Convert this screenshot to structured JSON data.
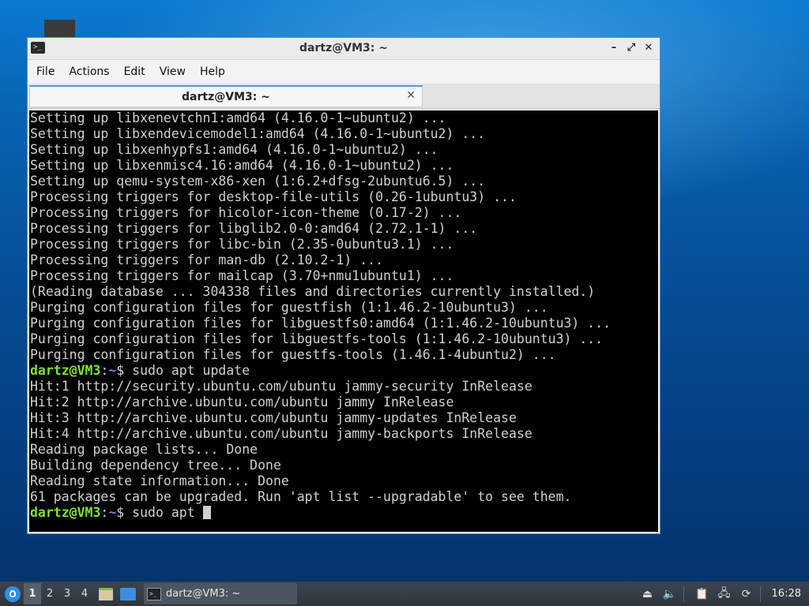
{
  "window": {
    "title": "dartz@VM3: ~",
    "controls": {
      "minimize": "–",
      "maximize": "⤢",
      "close": "✕"
    }
  },
  "menu": [
    "File",
    "Actions",
    "Edit",
    "View",
    "Help"
  ],
  "tab": {
    "label": "dartz@VM3: ~",
    "close": "✕"
  },
  "terminal": {
    "lines": [
      "Setting up libxenevtchn1:amd64 (4.16.0-1~ubuntu2) ...",
      "Setting up libxendevicemodel1:amd64 (4.16.0-1~ubuntu2) ...",
      "Setting up libxenhypfs1:amd64 (4.16.0-1~ubuntu2) ...",
      "Setting up libxenmisc4.16:amd64 (4.16.0-1~ubuntu2) ...",
      "Setting up qemu-system-x86-xen (1:6.2+dfsg-2ubuntu6.5) ...",
      "Processing triggers for desktop-file-utils (0.26-1ubuntu3) ...",
      "Processing triggers for hicolor-icon-theme (0.17-2) ...",
      "Processing triggers for libglib2.0-0:amd64 (2.72.1-1) ...",
      "Processing triggers for libc-bin (2.35-0ubuntu3.1) ...",
      "Processing triggers for man-db (2.10.2-1) ...",
      "Processing triggers for mailcap (3.70+nmu1ubuntu1) ...",
      "(Reading database ... 304338 files and directories currently installed.)",
      "Purging configuration files for guestfish (1:1.46.2-10ubuntu3) ...",
      "Purging configuration files for libguestfs0:amd64 (1:1.46.2-10ubuntu3) ...",
      "Purging configuration files for libguestfs-tools (1:1.46.2-10ubuntu3) ...",
      "Purging configuration files for guestfs-tools (1.46.1-4ubuntu2) ...",
      {
        "prompt_user": "dartz@VM3",
        "prompt_sep": ":",
        "prompt_path": "~",
        "prompt_end": "$ ",
        "command": "sudo apt update"
      },
      "Hit:1 http://security.ubuntu.com/ubuntu jammy-security InRelease",
      "Hit:2 http://archive.ubuntu.com/ubuntu jammy InRelease",
      "Hit:3 http://archive.ubuntu.com/ubuntu jammy-updates InRelease",
      "Hit:4 http://archive.ubuntu.com/ubuntu jammy-backports InRelease",
      "Reading package lists... Done",
      "Building dependency tree... Done",
      "Reading state information... Done",
      "61 packages can be upgraded. Run 'apt list --upgradable' to see them.",
      {
        "prompt_user": "dartz@VM3",
        "prompt_sep": ":",
        "prompt_path": "~",
        "prompt_end": "$ ",
        "command": "sudo apt ",
        "cursor": true
      }
    ]
  },
  "taskbar": {
    "workspaces": [
      "1",
      "2",
      "3",
      "4"
    ],
    "active_workspace": 0,
    "task_label": "dartz@VM3: ~",
    "clock": "16:28",
    "icons": {
      "start": "lubuntu-start-icon",
      "files": "file-manager-icon",
      "desktop": "show-desktop-icon",
      "tray": [
        "eject-icon",
        "volume-icon",
        "clipboard-icon",
        "network-icon",
        "update-notifier-icon"
      ]
    }
  },
  "colors": {
    "prompt_user": "#7ee03a",
    "prompt_path": "#5c8df0",
    "terminal_bg": "#000000",
    "terminal_fg": "#d0d0d0",
    "accent": "#5a9ad8"
  }
}
